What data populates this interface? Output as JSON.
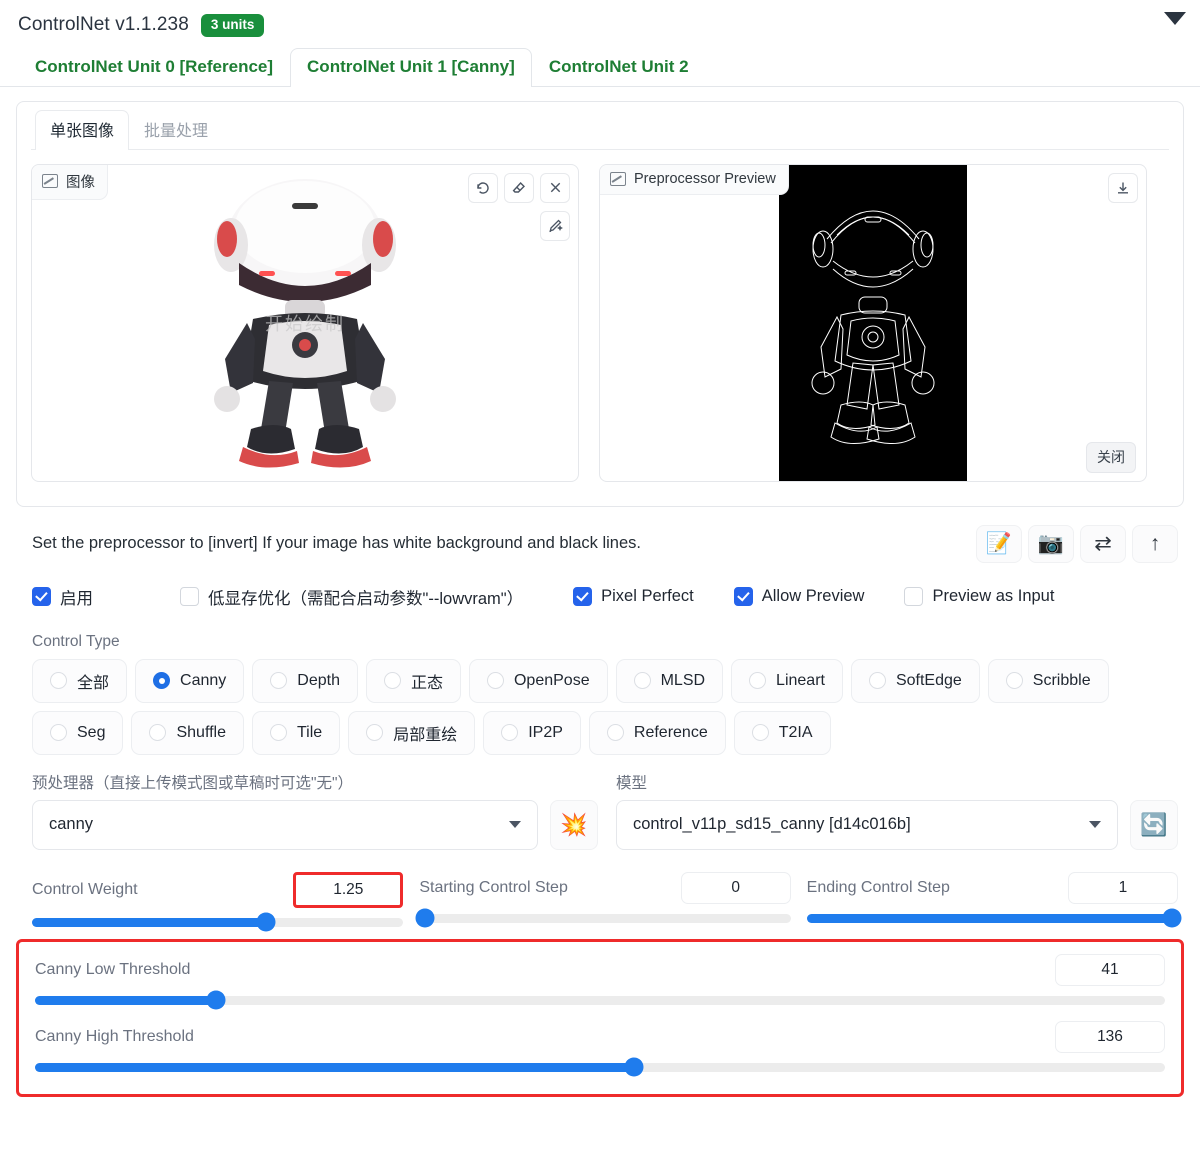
{
  "header": {
    "title": "ControlNet v1.1.238",
    "units_badge": "3 units",
    "collapse_icon": "triangle-down-icon"
  },
  "unit_tabs": [
    {
      "label": "ControlNet Unit 0 [Reference]",
      "active": false
    },
    {
      "label": "ControlNet Unit 1 [Canny]",
      "active": true
    },
    {
      "label": "ControlNet Unit 2",
      "active": false
    }
  ],
  "sub_tabs": [
    {
      "label": "单张图像",
      "active": true
    },
    {
      "label": "批量处理",
      "active": false
    }
  ],
  "image_panel": {
    "chip_label": "图像",
    "chip_icon": "image-icon",
    "watermark": "开始绘制",
    "tools": [
      {
        "name": "undo-icon",
        "glyph": "↺"
      },
      {
        "name": "eraser-icon",
        "glyph": "◇"
      },
      {
        "name": "close-icon",
        "glyph": "✕"
      }
    ],
    "draw_tool": {
      "name": "pen-sparkle-icon",
      "glyph": "✎"
    }
  },
  "preview_panel": {
    "chip_label": "Preprocessor Preview",
    "chip_icon": "image-icon",
    "download_icon": "download-icon",
    "close_label": "关闭"
  },
  "hint": {
    "text": "Set the preprocessor to [invert] If your image has white background and black lines.",
    "buttons": [
      {
        "name": "edit-note-icon",
        "glyph": "📝"
      },
      {
        "name": "camera-icon",
        "glyph": "📷"
      },
      {
        "name": "swap-arrows-icon",
        "glyph": "⇄"
      },
      {
        "name": "upload-arrow-icon",
        "glyph": "↑"
      }
    ]
  },
  "checkboxes": [
    {
      "label": "启用",
      "checked": true
    },
    {
      "label": "低显存优化（需配合启动参数\"--lowvram\"）",
      "checked": false
    },
    {
      "label": "Pixel Perfect",
      "checked": true
    },
    {
      "label": "Allow Preview",
      "checked": true
    },
    {
      "label": "Preview as Input",
      "checked": false
    }
  ],
  "control_type": {
    "label": "Control Type",
    "rows": [
      [
        {
          "label": "全部",
          "selected": false
        },
        {
          "label": "Canny",
          "selected": true
        },
        {
          "label": "Depth",
          "selected": false
        },
        {
          "label": "正态",
          "selected": false
        },
        {
          "label": "OpenPose",
          "selected": false
        },
        {
          "label": "MLSD",
          "selected": false
        },
        {
          "label": "Lineart",
          "selected": false
        },
        {
          "label": "SoftEdge",
          "selected": false
        },
        {
          "label": "Scribble",
          "selected": false
        }
      ],
      [
        {
          "label": "Seg",
          "selected": false
        },
        {
          "label": "Shuffle",
          "selected": false
        },
        {
          "label": "Tile",
          "selected": false
        },
        {
          "label": "局部重绘",
          "selected": false
        },
        {
          "label": "IP2P",
          "selected": false
        },
        {
          "label": "Reference",
          "selected": false
        },
        {
          "label": "T2IA",
          "selected": false
        }
      ]
    ]
  },
  "preprocessor": {
    "label": "预处理器（直接上传模式图或草稿时可选\"无\"）",
    "value": "canny",
    "run_button_icon": "explosion-icon",
    "run_button_glyph": "💥"
  },
  "model": {
    "label": "模型",
    "value": "control_v11p_sd15_canny [d14c016b]",
    "refresh_button_icon": "refresh-icon",
    "refresh_button_glyph": "🔄"
  },
  "sliders": {
    "control_weight": {
      "label": "Control Weight",
      "value": "1.25",
      "percent": 63,
      "highlighted": true
    },
    "starting_step": {
      "label": "Starting Control Step",
      "value": "0",
      "percent": 0,
      "highlighted": false
    },
    "ending_step": {
      "label": "Ending Control Step",
      "value": "1",
      "percent": 100,
      "highlighted": false
    },
    "canny_low": {
      "label": "Canny Low Threshold",
      "value": "41",
      "percent": 16,
      "highlighted": false
    },
    "canny_high": {
      "label": "Canny High Threshold",
      "value": "136",
      "percent": 53,
      "highlighted": false
    }
  },
  "colors": {
    "accent_green": "#198f3c",
    "slider_blue": "#1f7ced",
    "checkbox_blue": "#2563eb",
    "highlight_red": "#ef2b2b"
  }
}
